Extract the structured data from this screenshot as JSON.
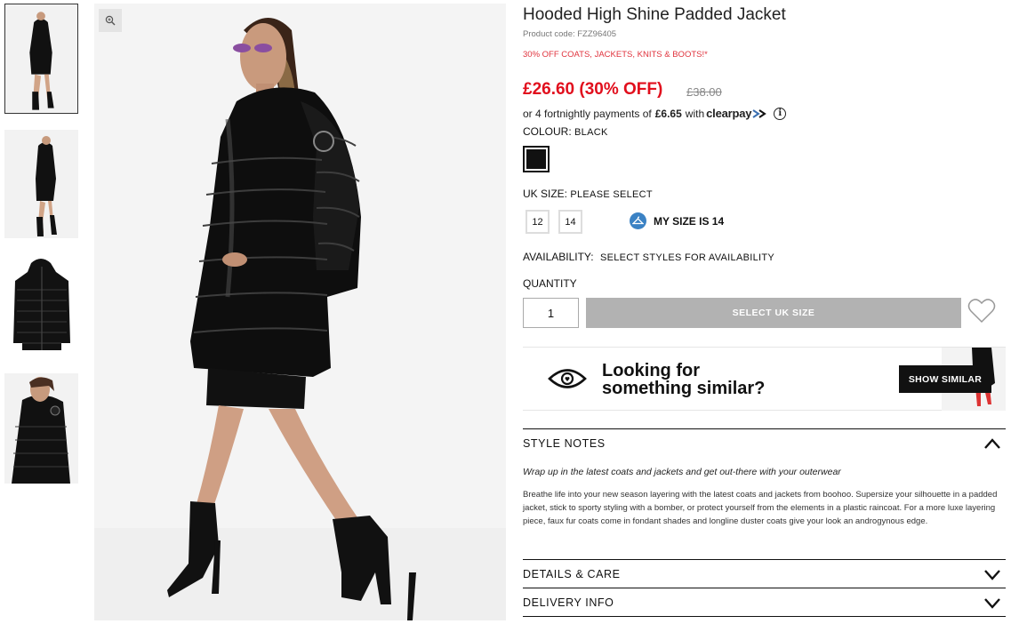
{
  "product": {
    "title": "Hooded High Shine Padded Jacket",
    "code": "Product code: FZZ96405",
    "promo": "30% OFF COATS, JACKETS, KNITS & BOOTS!*",
    "price": "£26.60 (30% OFF)",
    "was_price": "£38.00",
    "clearpay_prefix": "or 4 fortnightly payments of",
    "clearpay_amount": "£6.65",
    "clearpay_with": "with",
    "clearpay_brand": "clearpay"
  },
  "colour": {
    "label": "COLOUR:",
    "value": "BLACK",
    "swatch": "#111111"
  },
  "size": {
    "label": "UK SIZE:",
    "value": "PLEASE SELECT",
    "options": [
      "12",
      "14"
    ],
    "my_size": "MY SIZE IS 14"
  },
  "availability": {
    "label": "AVAILABILITY:",
    "value": "SELECT STYLES FOR AVAILABILITY"
  },
  "quantity": {
    "label": "QUANTITY",
    "value": "1"
  },
  "add_button": "SELECT UK SIZE",
  "similar": {
    "line1": "Looking for",
    "line2": "something similar?",
    "button": "SHOW SIMILAR"
  },
  "style_notes": {
    "heading": "STYLE NOTES",
    "intro": "Wrap up in the latest coats and jackets and get out-there with your outerwear",
    "body": "Breathe life into your new season layering with the latest coats and jackets from boohoo. Supersize your silhouette in a padded jacket, stick to sporty styling with a bomber, or protect yourself from the elements in a plastic raincoat. For a more luxe layering piece, faux fur coats come in fondant shades and longline duster coats give your look an androgynous edge."
  },
  "details_care": {
    "heading": "DETAILS & CARE"
  },
  "delivery_info": {
    "heading": "DELIVERY INFO"
  },
  "icons": {
    "zoom": "zoom-icon",
    "info": "info-icon",
    "hanger": "hanger-icon",
    "heart": "heart-icon",
    "eye": "eye-icon",
    "chevron": "chevron-icon"
  },
  "colors": {
    "sale_red": "#e10f1d",
    "promo_red": "#e0333d",
    "disabled_btn": "#b2b2b2",
    "hanger_blue": "#3b82c4"
  }
}
